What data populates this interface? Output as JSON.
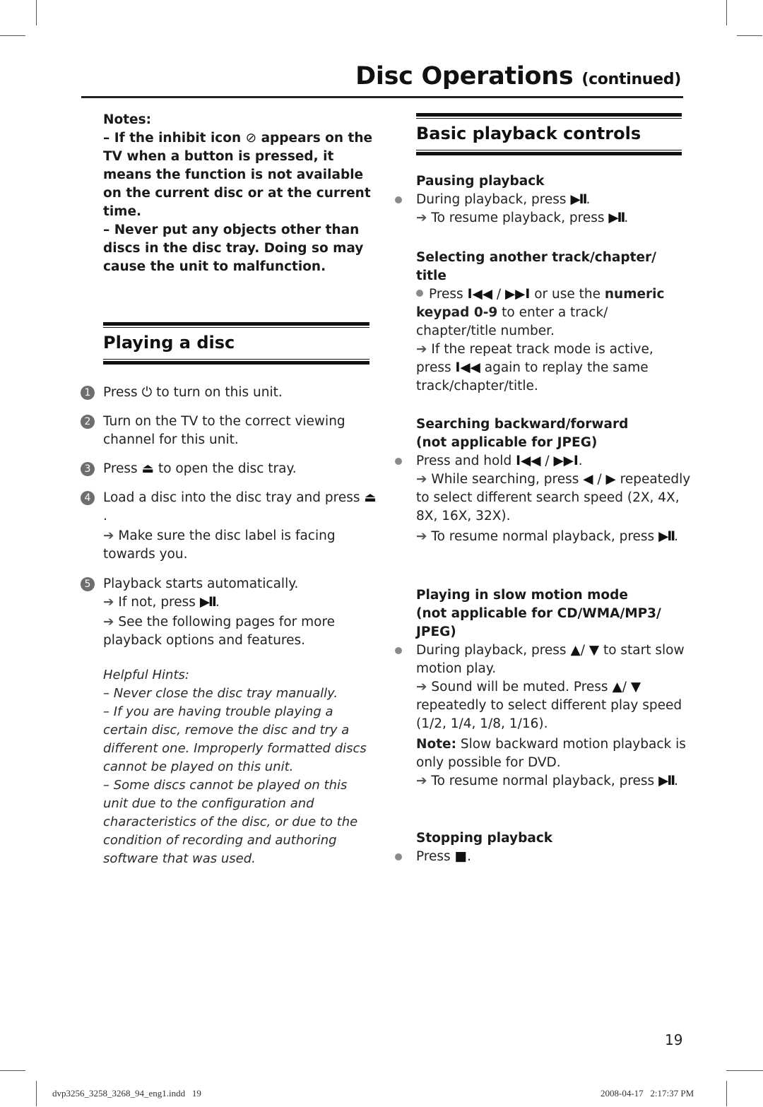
{
  "header": {
    "title": "Disc Operations",
    "title_suffix": "(continued)"
  },
  "notes": {
    "heading": "Notes:",
    "items": [
      {
        "prefix": "–  If the inhibit icon",
        "icon": "inhibit-icon",
        "icon_glyph": "⊘",
        "suffix": "appears on the TV when a button is pressed, it means the function is not available on the current disc or at the current time."
      },
      {
        "text": "–  Never put any objects other than discs in the disc tray. Doing so may cause the unit to malfunction."
      }
    ]
  },
  "playing_disc": {
    "heading": "Playing a disc",
    "steps": [
      {
        "number": "1",
        "pre": "Press",
        "icon": "power-icon",
        "glyph": "⏻",
        "post": "to turn on this unit."
      },
      {
        "number": "2",
        "text": "Turn on the TV to the correct viewing channel for this unit."
      },
      {
        "number": "3",
        "pre": "Press",
        "icon": "eject-icon",
        "glyph": "⏏",
        "post": "to open the disc tray."
      },
      {
        "number": "4",
        "pre": "Load a disc into the disc tray and press",
        "icon": "eject-icon",
        "glyph": "⏏",
        "post": ".",
        "sub": "Make sure the disc label is facing towards you."
      },
      {
        "number": "5",
        "text": "Playback starts automatically.",
        "sub1_pre": "If not, press",
        "sub1_glyph": "▶II",
        "sub1_post": ".",
        "sub2": "See the following pages for more playback options and features."
      }
    ],
    "arrow_glyph": "➔"
  },
  "hints": {
    "heading": "Helpful Hints:",
    "items": [
      "–  Never close the disc tray manually.",
      "–  If you are having trouble playing a certain disc, remove the disc and try a different one. Improperly formatted discs cannot be played on this unit.",
      "–  Some discs cannot be played on this unit due to the configuration and characteristics of the disc, or due to the condition of recording and authoring software that was used."
    ]
  },
  "basic_controls": {
    "heading": "Basic playback controls",
    "pausing": {
      "title": "Pausing playback",
      "line1_pre": "During playback, press",
      "line1_glyph": "▶II",
      "line1_post": ".",
      "line2_pre": "To resume playback, press",
      "line2_glyph": "▶II",
      "line2_post": "."
    },
    "selecting": {
      "title": "Selecting another track/chapter/ title",
      "line1_pre": "Press",
      "prev_glyph": "I◀◀",
      "sep": "/",
      "next_glyph": "▶▶I",
      "line1_post": "or use the",
      "keypad_bold": "numeric keypad 0-9",
      "keypad_rest": "to enter a track/ chapter/title number.",
      "repeat_pre": "If the repeat track mode is active, press",
      "repeat_glyph": "I◀◀",
      "repeat_post": "again to replay the same track/chapter/title."
    },
    "searching": {
      "title_line1": "Searching backward/forward",
      "title_line2": "(not applicable for JPEG)",
      "line1_pre": "Press and hold",
      "prev_glyph": "I◀◀",
      "sep": "/",
      "next_glyph": "▶▶I",
      "line1_post": ".",
      "sub1_pre": "While searching, press",
      "left_glyph": "◀",
      "right_glyph": "▶",
      "sub1_post": "repeatedly to select different search speed (2X, 4X, 8X, 16X, 32X).",
      "sub2_pre": "To resume normal playback, press",
      "sub2_glyph": "▶II",
      "sub2_post": "."
    },
    "slow_motion": {
      "title_line1": "Playing in slow motion mode",
      "title_line2": "(not applicable for CD/WMA/MP3/",
      "title_line3": "JPEG)",
      "line1_pre": "During playback, press",
      "up_glyph": "▲",
      "down_glyph": "▼",
      "line1_post": "to start slow motion play.",
      "sub1_pre": "Sound will be muted. Press",
      "sub1_post": "repeatedly to select different play speed (1/2, 1/4, 1/8, 1/16).",
      "note_label": "Note:",
      "note_text": "Slow backward motion playback is only possible for DVD.",
      "sub2_pre": "To resume normal playback, press",
      "sub2_glyph": "▶II",
      "sub2_post": "."
    },
    "stopping": {
      "title": "Stopping playback",
      "line_pre": "Press",
      "stop_glyph": "■",
      "line_post": "."
    }
  },
  "footer": {
    "page_number": "19",
    "file_name": "dvp3256_3258_3268_94_eng1.indd   19",
    "timestamp": "2008-04-17   2:17:37 PM"
  }
}
